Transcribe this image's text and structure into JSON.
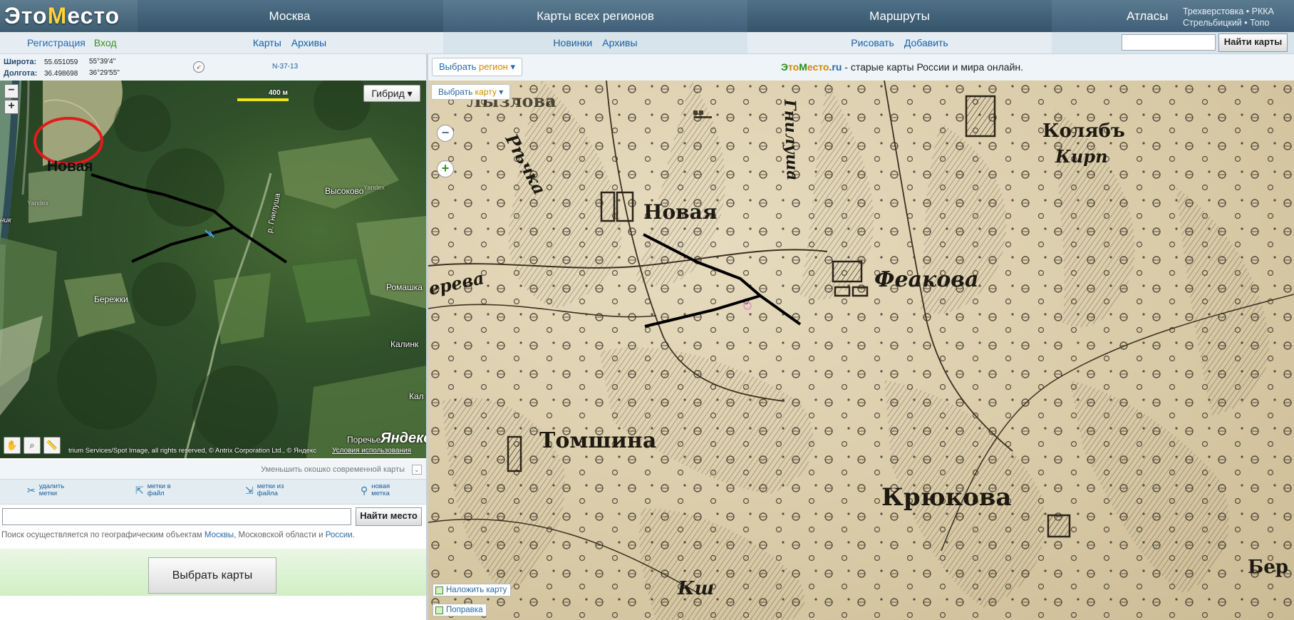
{
  "logo": {
    "text_e": "Э",
    "text_to": "то",
    "text_m": "М",
    "text_esto": "есто"
  },
  "nav": {
    "moscow": "Москва",
    "regions": "Карты всех регионов",
    "routes": "Маршруты",
    "atlases": "Атласы",
    "atlas_sub1": "Трехверстовка • РККА",
    "atlas_sub2": "Стрельбицкий • Топо"
  },
  "subnav": {
    "register": "Регистрация",
    "login": "Вход",
    "maps": "Карты",
    "archives1": "Архивы",
    "news": "Новинки",
    "archives2": "Архивы",
    "draw": "Рисовать",
    "add": "Добавить",
    "find_maps": "Найти карты"
  },
  "coords": {
    "lat_label": "Широта:",
    "lat_dec": "55.651059",
    "lat_dms": "55°39'4\"",
    "lon_label": "Долгота:",
    "lon_dec": "36.498698",
    "lon_dms": "36°29'55\"",
    "sheet": "N-37-13"
  },
  "satmap": {
    "zoom_out": "−",
    "zoom_in": "+",
    "scale": "400 м",
    "hybrid": "Гибрид",
    "labels": {
      "novaya": "Новая",
      "vysokovo": "Высоково",
      "river": "р. Гнилуша",
      "berezhki": "Бережки",
      "romashka": "Ромашка",
      "kalinka": "Калинк",
      "kal": "Кал",
      "poreche": "Поречье",
      "nik": "ник",
      "yandex_small": "Yandex",
      "yandex_small2": "Yandex"
    },
    "copyright": "trium Services/Spot Image, all rights reserved, © Antrix Corporation Ltd., © Яндекс",
    "terms": "Условия использования",
    "yandex_logo": "Яндекс"
  },
  "shrink": "Уменьшить окошко современной карты",
  "marker_tools": [
    {
      "line1": "удалить",
      "line2": "метки"
    },
    {
      "line1": "метки в",
      "line2": "файл"
    },
    {
      "line1": "метки из",
      "line2": "файла"
    },
    {
      "line1": "новая",
      "line2": "метка"
    }
  ],
  "place_search": {
    "button": "Найти место",
    "note_prefix": "Поиск осуществляется по географическим объектам ",
    "note_moscow": "Москвы",
    "note_mid": ", Московской области и ",
    "note_russia": "России",
    "note_end": "."
  },
  "choose_maps": "Выбрать карты",
  "right": {
    "choose_region_1": "Выбрать ",
    "choose_region_2": "регион",
    "choose_map_1": "Выбрать ",
    "choose_map_2": "карту",
    "tagline_e": "Э",
    "tagline_to": "то",
    "tagline_m": "М",
    "tagline_esto": "есто",
    "tagline_ru": ".ru",
    "tagline_rest": " - старые карты России и мира онлайн.",
    "overlay": "Наложить карту",
    "correction": "Поправка"
  },
  "oldmap_labels": {
    "novaya": "Новая",
    "feakova": "Феакова",
    "tomshina": "Томшина",
    "kryukova": "Крюкова",
    "kolyab": "Колябъ",
    "kirp": "Кирп",
    "lyzlova": "Лызлова",
    "ber": "Бер",
    "rechka": "Рѣчка",
    "gniluscha": "Гнилуша",
    "dereva": "ерева",
    "ksh": "Кш"
  },
  "colors": {
    "nav_bg": "#3e5d71",
    "accent_green": "#3c8e25",
    "accent_orange": "#d08a00",
    "link_blue": "#1a5fa0"
  }
}
